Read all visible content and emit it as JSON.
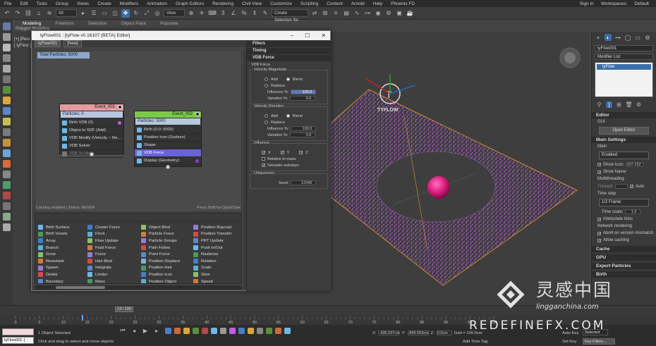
{
  "app": {
    "menu": [
      "File",
      "Edit",
      "Tools",
      "Group",
      "Views",
      "Create",
      "Modifiers",
      "Animation",
      "Graph Editors",
      "Rendering",
      "Civil View",
      "Customize",
      "Scripting",
      "Content",
      "Arnold",
      "Help",
      "Phoenix FD"
    ],
    "sign_in": "Sign In",
    "workspaces_label": "Workspaces:",
    "workspace_value": "Default"
  },
  "toolbar": {
    "filter": "All",
    "view": "View",
    "selection_set": "Create Selection Se"
  },
  "ribbon": {
    "tabs": [
      "Modeling",
      "Freeform",
      "Selection",
      "Object Paint",
      "Populate"
    ],
    "active": "Modeling",
    "sub": "Polygon Modeling"
  },
  "viewport": {
    "label": "[+] [Pers",
    "tab": "[ tyFlow ]",
    "logo_text": "TYFLOW"
  },
  "tyflow": {
    "title": "tyFlow001 : [tyFlow v0.16107 (BETA) Editor]",
    "tabs": [
      "tyFlow001",
      "[New]"
    ],
    "total_particles": "Total Particles: 5000",
    "event1": {
      "name": "Event_001",
      "particles": "Particles: 0",
      "ops": [
        "Birth VDB (0)",
        "Object to SDF (Add)",
        "VDB Modify (Velocity ~ No...",
        "VDB Solver",
        "VDB To Mesh"
      ]
    },
    "event2": {
      "name": "Event_002",
      "particles": "Particles: 5000",
      "ops": [
        "Birth (0-0: 5000)",
        "Position Icon (Surface)",
        "Shape",
        "VDB Force",
        "Display (Geometry)"
      ]
    },
    "status_left": "Caching enabled | Status: NEVER",
    "status_right": "Press Shift for QuickType",
    "operators": [
      [
        "Birth Surface",
        "Birth Voxels",
        "Array",
        "Branch",
        "Grow",
        "Resample",
        "Spawn",
        "Delete",
        "Boundary"
      ],
      [
        "Cluster Force",
        "Flock",
        "Flow Update",
        "Fluid Force",
        "Force",
        "Hair Bind",
        "Integrate",
        "Limiter",
        "Mass"
      ],
      [
        "Object Bind",
        "Particle Force",
        "Particle Groups",
        "Path Follow",
        "Point Force",
        "Position Displace",
        "Position Hair",
        "Position Icon",
        "Position Object"
      ],
      [
        "Position Raycast",
        "Position Transfer",
        "PRT Update",
        "Push In/Out",
        "Rasterize",
        "Rotation",
        "Scale",
        "Slow",
        "Speed"
      ]
    ]
  },
  "properties": {
    "sections": [
      "Filters",
      "Timing",
      "VDB Force"
    ],
    "sub": "VDB Force",
    "velocity_magnitude": {
      "title": "Velocity Magnitude",
      "add": "Add",
      "blend": "Blend",
      "replace": "Replace",
      "influence_label": "Influence %:",
      "influence": "100.0",
      "variation_label": "Variation %:",
      "variation": "0.0"
    },
    "velocity_direction": {
      "title": "Velocity Direction",
      "add": "Add",
      "blend": "Blend",
      "replace": "Replace",
      "influence_label": "Influence %:",
      "influence": "100.0",
      "variation_label": "Variation %:",
      "variation": "0.0"
    },
    "influence": {
      "title": "Influence",
      "x": "X",
      "y": "Y",
      "z": "Z",
      "relative_to_mass": "Relative to mass",
      "simulate_substeps": "Simulate substeps"
    },
    "uniqueness": {
      "title": "Uniqueness",
      "seed_label": "Seed:",
      "seed": "12345"
    }
  },
  "right_panel": {
    "object_name": "tyFlow001",
    "modifier_list": "Modifier List",
    "stack_item": "tyFlow",
    "editor_title": "Editor",
    "gui": "GUI",
    "open_editor": "Open Editor",
    "main_settings": "Main Settings",
    "main": "Main",
    "enabled": "Enabled",
    "show_icon": "Show Icon:",
    "icon_size": "107.152",
    "show_name": "Show Name",
    "multithreading": "Multithreading",
    "threads": "Threads",
    "auto": "Auto",
    "time_step": "Time step",
    "frame_value": "1/2 Frame",
    "time_scale_label": "Time scale:",
    "time_scale": "1.0",
    "interpolate": "Interpolate ticks",
    "network_rendering": "Network rendering",
    "abort": "Abort on version mismatch",
    "allow_caching": "Allow caching",
    "cache": "Cache",
    "gpu": "GPU",
    "export_particles": "Export Particles",
    "birth": "Birth"
  },
  "timeline": {
    "slider": "14 / 100",
    "ticks": [
      "0",
      "5",
      "10",
      "15",
      "20",
      "25",
      "30",
      "35",
      "40",
      "45",
      "50",
      "55",
      "60",
      "65",
      "70",
      "75",
      "80",
      "85",
      "90",
      "95",
      "100"
    ]
  },
  "status": {
    "maxscript": "tyFlow001: [",
    "selected": "1 Object Selected",
    "hint": "Click and drag to select and move objects",
    "x_label": "X:",
    "x": "-436.537cm",
    "y_label": "Y:",
    "y": "-845.563cm",
    "z_label": "Z:",
    "z": "0.0cm",
    "grid": "Grid = 100.0cm",
    "add_time_tag": "Add Time Tag",
    "auto_key": "Auto Key",
    "selected_dd": "Selected",
    "set_key": "Set Key",
    "key_filters": "Key Filters..."
  },
  "watermark": {
    "cn": "灵感中国",
    "url": "lingganchina.com",
    "brand": "REDEFINEFX.COM"
  },
  "colors": {
    "particles": "#c45ce6",
    "sphere": "#d81b7a",
    "event1_header": "#e39ba0",
    "event2_header": "#7cc94a",
    "selected_op": "#6a63d8",
    "plane_edge": "#c98a33"
  }
}
